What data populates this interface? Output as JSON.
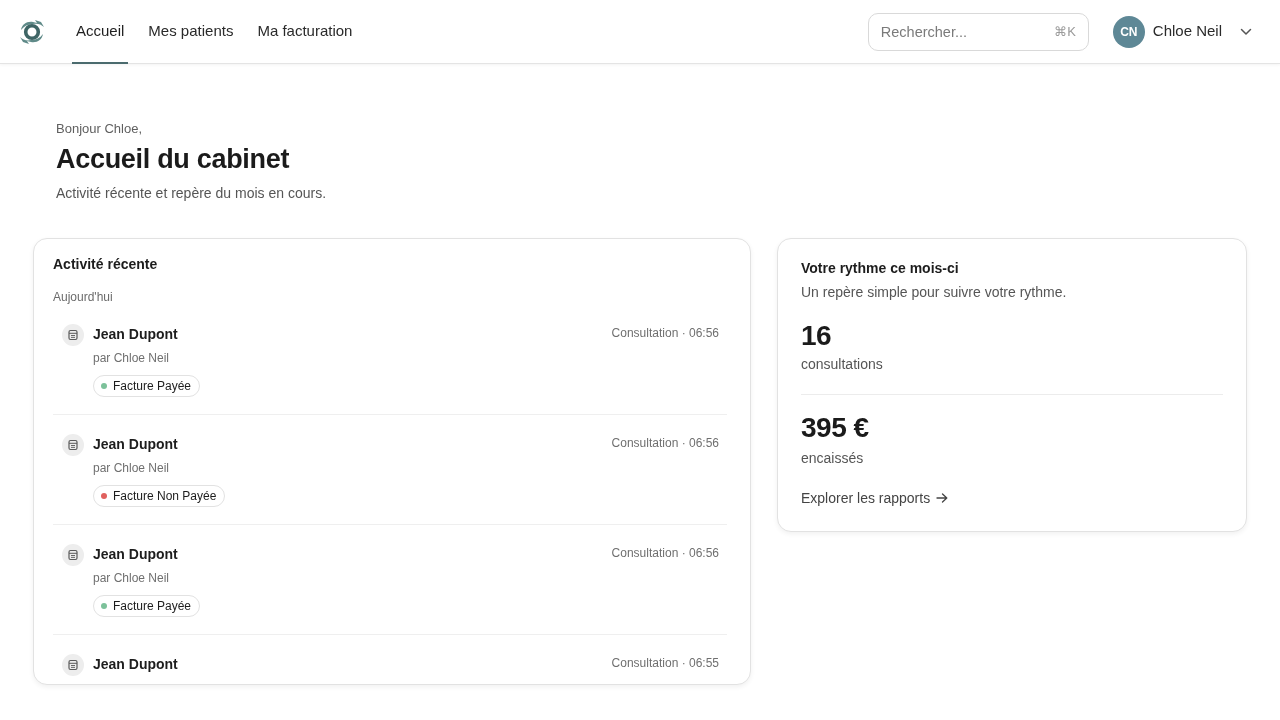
{
  "navbar": {
    "links": [
      {
        "label": "Accueil",
        "selected": true
      },
      {
        "label": "Mes patients",
        "selected": false
      },
      {
        "label": "Ma facturation",
        "selected": false
      }
    ],
    "search": {
      "placeholder": "Rechercher...",
      "shortcut": "⌘K"
    },
    "user": {
      "initials": "CN",
      "name": "Chloe Neil"
    }
  },
  "header": {
    "greeting": "Bonjour Chloe,",
    "title": "Accueil du cabinet",
    "subtitle": "Activité récente et repère du mois en cours."
  },
  "activity": {
    "title": "Activité récente",
    "group_label": "Aujourd'hui",
    "items": [
      {
        "name": "Jean Dupont",
        "meta": "Consultation · 06:56",
        "author": "par Chloe Neil",
        "status": {
          "label": "Facture Payée",
          "color": "#7cc19a"
        }
      },
      {
        "name": "Jean Dupont",
        "meta": "Consultation · 06:56",
        "author": "par Chloe Neil",
        "status": {
          "label": "Facture Non Payée",
          "color": "#e0605e"
        }
      },
      {
        "name": "Jean Dupont",
        "meta": "Consultation · 06:56",
        "author": "par Chloe Neil",
        "status": {
          "label": "Facture Payée",
          "color": "#7cc19a"
        }
      },
      {
        "name": "Jean Dupont",
        "meta": "Consultation · 06:55"
      }
    ]
  },
  "rhythm": {
    "title": "Votre rythme ce mois-ci",
    "subtitle": "Un repère simple pour suivre votre rythme.",
    "stats": [
      {
        "value": "16",
        "label": "consultations"
      },
      {
        "value": "395 €",
        "label": "encaissés"
      }
    ],
    "link": "Explorer les rapports"
  }
}
